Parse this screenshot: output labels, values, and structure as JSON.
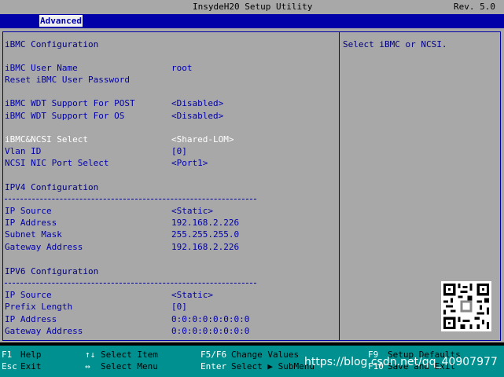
{
  "title": "InsydeH20 Setup Utility",
  "revision": "Rev. 5.0",
  "tab": "Advanced",
  "section_title": "iBMC Configuration",
  "help_text": "Select iBMC or NCSI.",
  "items": [
    {
      "label": "iBMC User Name",
      "value": "root"
    },
    {
      "label": "Reset iBMC User Password",
      "value": ""
    },
    {
      "label": "iBMC WDT Support For POST",
      "value": "<Disabled>"
    },
    {
      "label": "iBMC WDT Support For OS",
      "value": "<Disabled>"
    },
    {
      "label": "iBMC&NCSI Select",
      "value": "<Shared-LOM>"
    },
    {
      "label": "Vlan ID",
      "value": "[0]"
    },
    {
      "label": "NCSI NIC Port Select",
      "value": "<Port1>"
    }
  ],
  "ipv4": {
    "title": "IPV4 Configuration",
    "rows": [
      {
        "label": "IP Source",
        "value": "<Static>"
      },
      {
        "label": "IP Address",
        "value": "192.168.2.226"
      },
      {
        "label": "Subnet Mask",
        "value": "255.255.255.0"
      },
      {
        "label": "Gateway Address",
        "value": "192.168.2.226"
      }
    ]
  },
  "ipv6": {
    "title": "IPV6 Configuration",
    "rows": [
      {
        "label": "IP Source",
        "value": "<Static>"
      },
      {
        "label": "Prefix Length",
        "value": "[0]"
      },
      {
        "label": "IP Address",
        "value": "0:0:0:0:0:0:0:0"
      },
      {
        "label": "Gateway Address",
        "value": "0:0:0:0:0:0:0:0"
      }
    ]
  },
  "footer": {
    "f1_key": "F1",
    "f1_desc": "Help",
    "esc_key": "Esc",
    "esc_desc": "Exit",
    "updown_key": "↑↓",
    "updown_desc": "Select Item",
    "lr_key": "↔",
    "lr_desc": "Select Menu",
    "f5f6_key": "F5/F6",
    "f5f6_desc": "Change Values",
    "enter_key": "Enter",
    "enter_desc": "Select ▶ SubMenu",
    "f9_key": "F9",
    "f9_desc": "Setup Defaults",
    "f10_key": "F10",
    "f10_desc": "Save and Exit"
  },
  "watermark": "https://blog.csdn.net/qq_40907977"
}
